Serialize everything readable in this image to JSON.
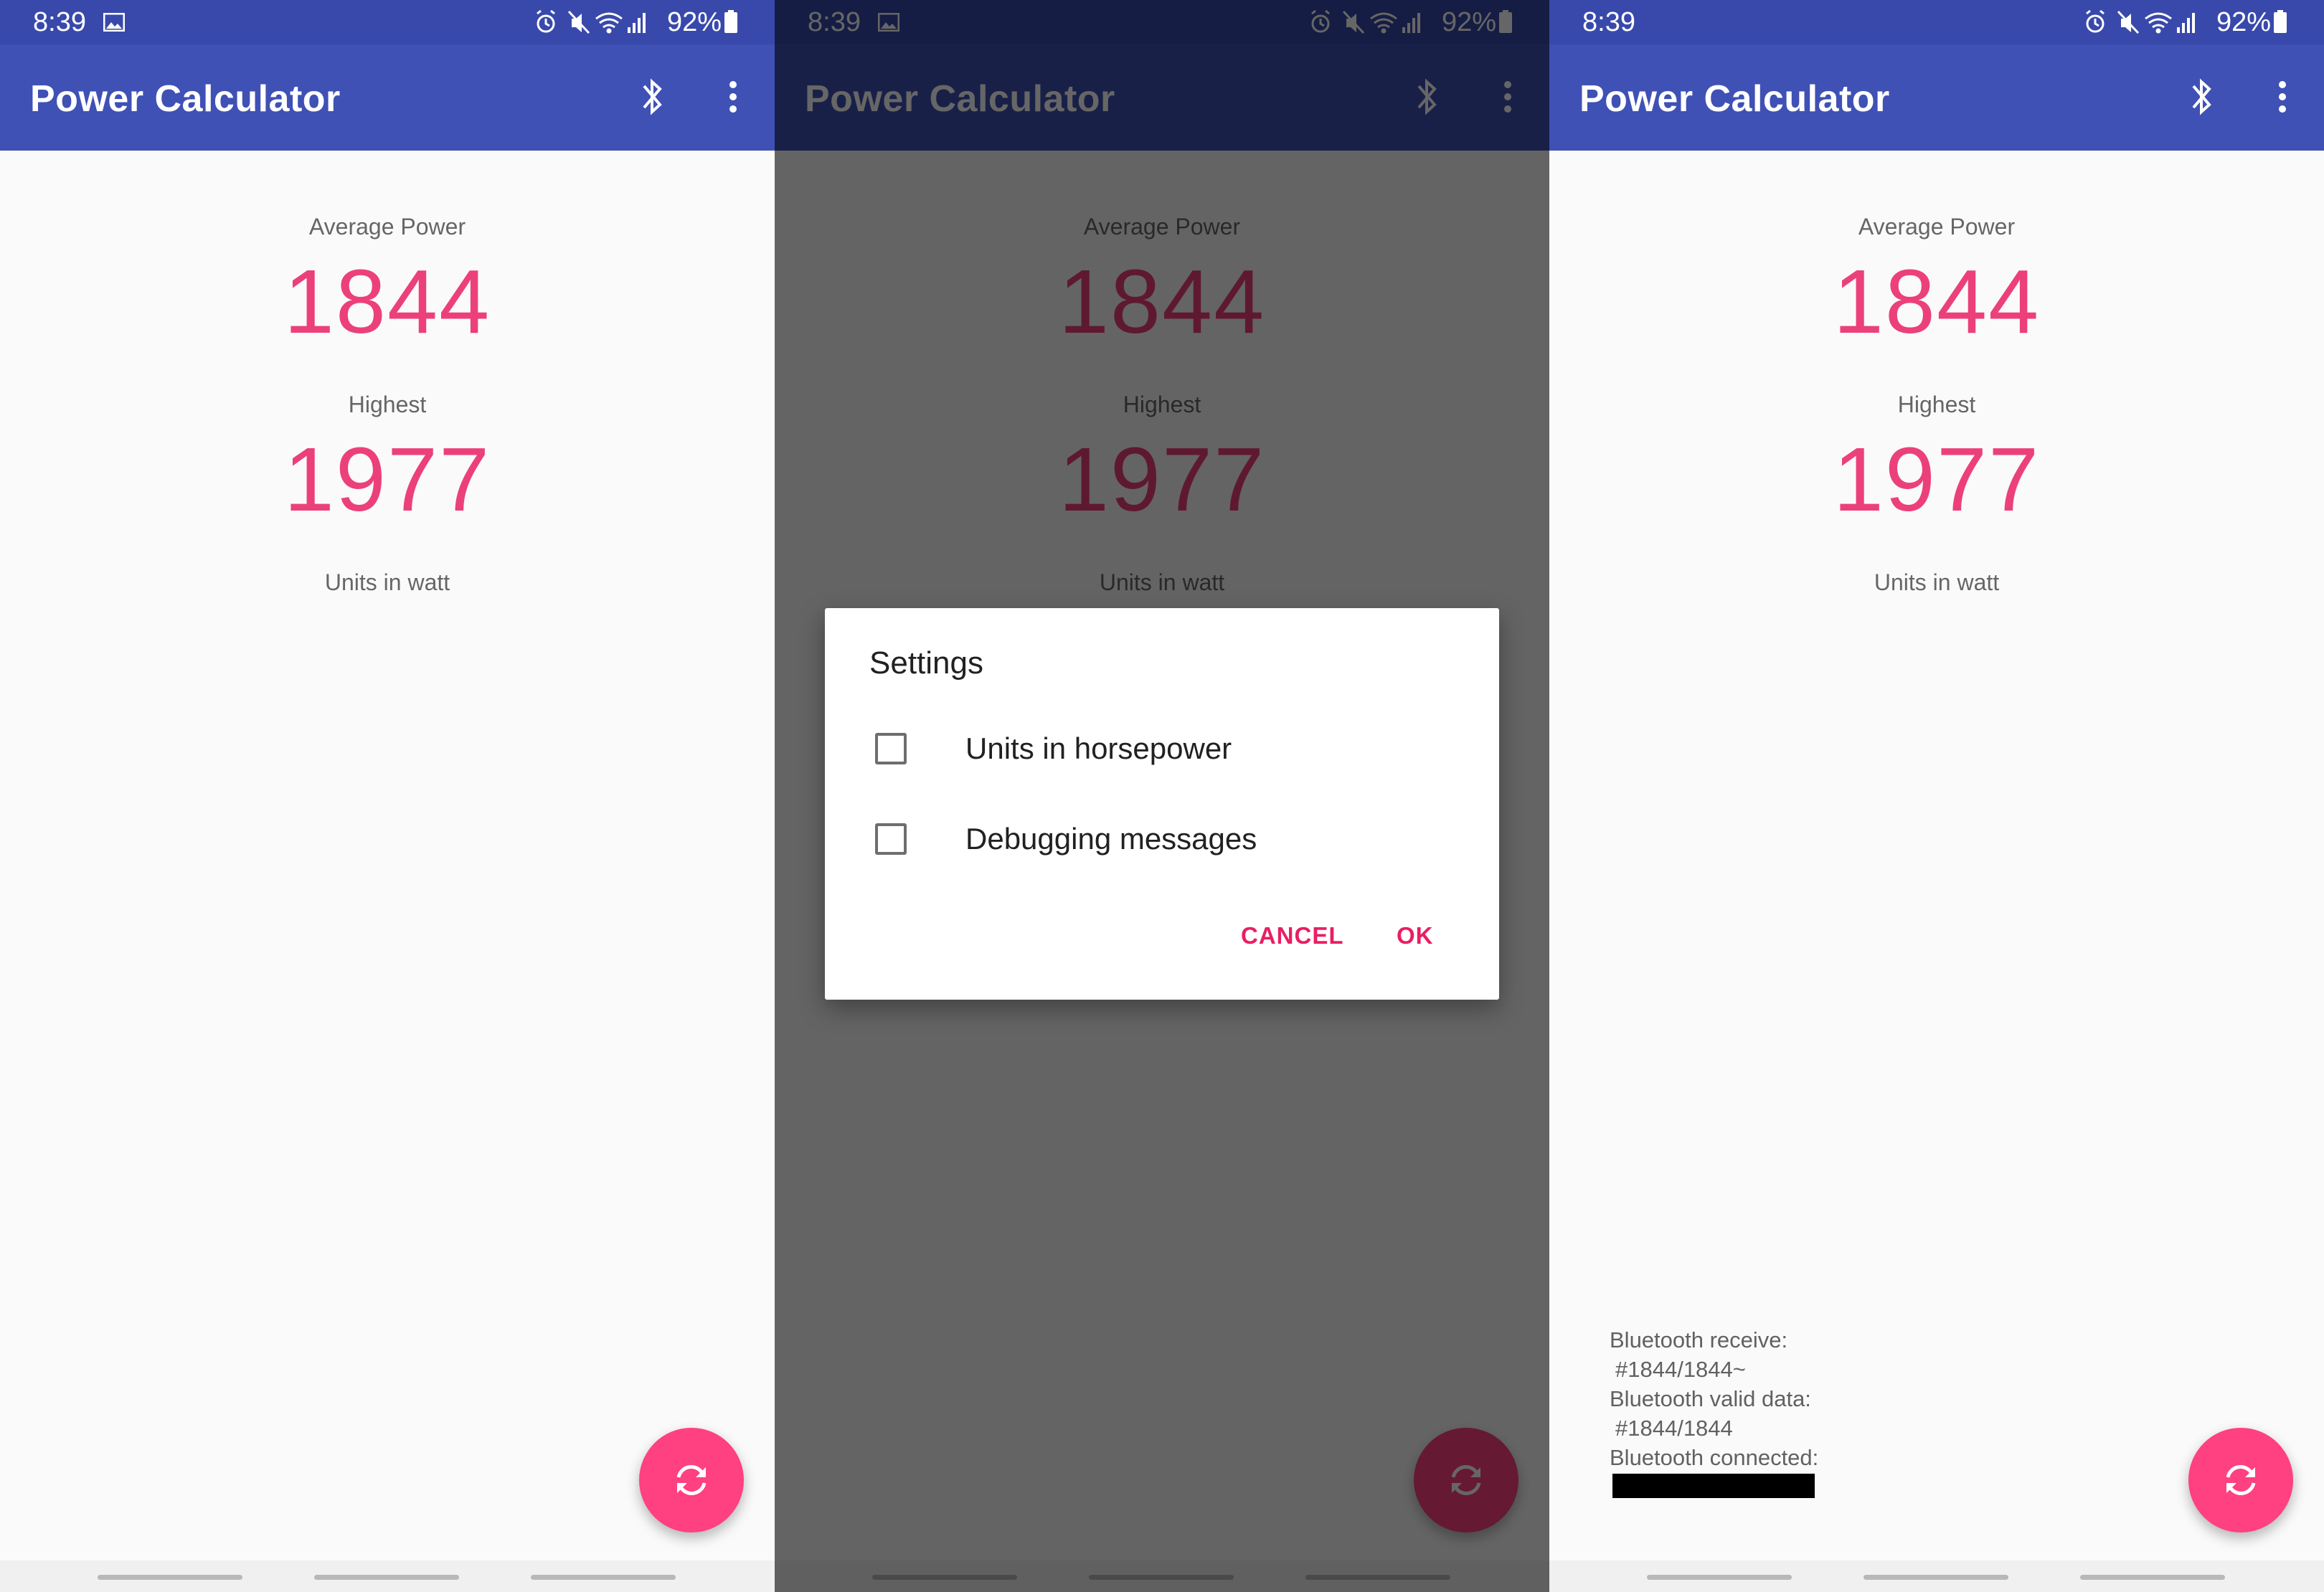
{
  "status": {
    "time": "8:39",
    "battery": "92%",
    "icons": [
      "image-icon",
      "alarm-icon",
      "mute-icon",
      "wifi-icon",
      "signal-icon",
      "battery-icon"
    ]
  },
  "app": {
    "title": "Power Calculator",
    "icons": [
      "bluetooth-icon",
      "overflow-menu-icon"
    ]
  },
  "main": {
    "avg_label": "Average Power",
    "avg_value": "1844",
    "high_label": "Highest",
    "high_value": "1977",
    "units": "Units in watt"
  },
  "fab": {
    "icon": "refresh-icon"
  },
  "dialog": {
    "title": "Settings",
    "options": [
      {
        "label": "Units in horsepower",
        "checked": false
      },
      {
        "label": "Debugging messages",
        "checked": false
      }
    ],
    "cancel": "CANCEL",
    "ok": "OK"
  },
  "debug": {
    "receive_label": "Bluetooth receive:",
    "receive_value": "#1844/1844~",
    "valid_label": "Bluetooth valid data:",
    "valid_value": "#1844/1844",
    "connected_label": "Bluetooth connected:"
  },
  "colors": {
    "primary": "#3f51b5",
    "primary_dark": "#3949ab",
    "accent": "#ff4081",
    "value_pink": "#ec407a",
    "button_pink": "#e91e63"
  }
}
